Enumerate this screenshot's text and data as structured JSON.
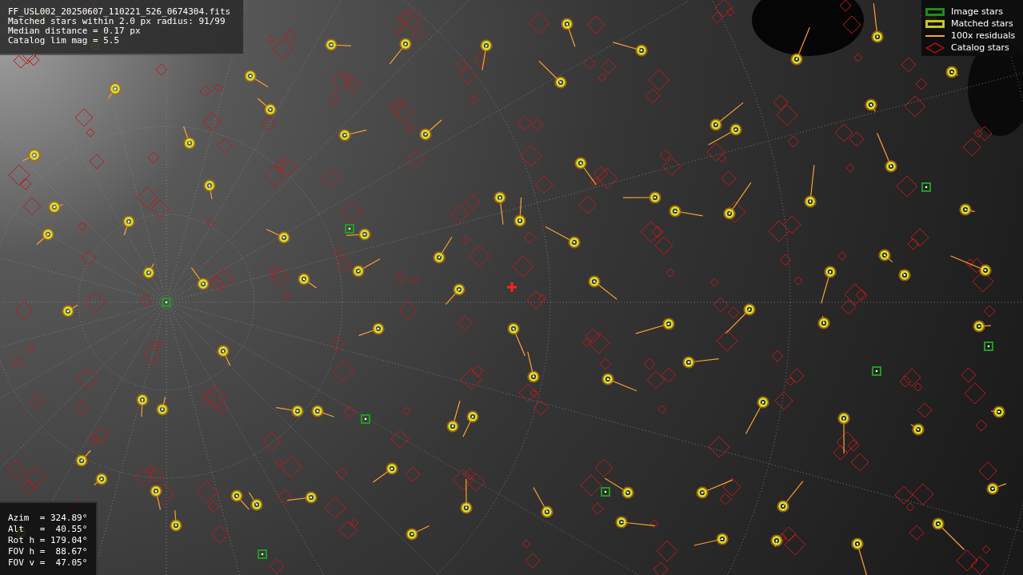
{
  "info_lines": [
    "FF_USL002_20250607_110221_526_0674304.fits",
    "Matched stars within 2.0 px radius: 91/99",
    "Median distance = 0.17 px",
    "Catalog lim mag = 5.5"
  ],
  "pointing_lines": [
    "Azim  = 324.89°",
    "Alt   =  40.55°",
    "Rot h = 179.04°",
    "FOV h =  88.67°",
    "FOV v =  47.05°"
  ],
  "legend": [
    {
      "kind": "box",
      "color": "#1e8c1e",
      "label": "Image stars"
    },
    {
      "kind": "box",
      "color": "#c8c81e",
      "label": "Matched stars"
    },
    {
      "kind": "line",
      "color": "#ffa030",
      "label": "100x residuals"
    },
    {
      "kind": "diamond",
      "color": "#b01010",
      "label": "Catalog stars"
    }
  ]
}
